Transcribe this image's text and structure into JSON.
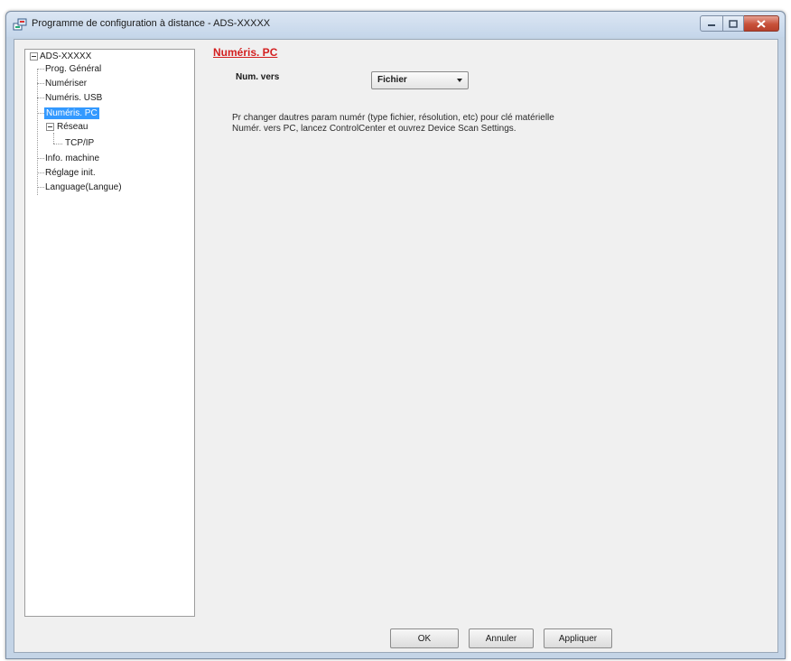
{
  "window": {
    "title": "Programme de configuration à distance - ADS-XXXXX",
    "icon": "remote-setup-app-icon"
  },
  "tree": {
    "root": "ADS-XXXXX",
    "items": [
      {
        "label": "Prog. Général"
      },
      {
        "label": "Numériser"
      },
      {
        "label": "Numéris. USB"
      },
      {
        "label": "Numéris. PC",
        "selected": true
      },
      {
        "label": "Réseau"
      },
      {
        "label": "TCP/IP"
      },
      {
        "label": "Info. machine"
      },
      {
        "label": "Réglage init."
      },
      {
        "label": "Language(Langue)"
      }
    ]
  },
  "panel": {
    "title": "Numéris. PC",
    "scan_to_label": "Num. vers",
    "scan_to_value": "Fichier",
    "info_line1": "Pr changer dautres param numér (type fichier, résolution, etc) pour clé matérielle",
    "info_line2": "Numér. vers PC, lancez ControlCenter et ouvrez Device Scan Settings."
  },
  "buttons": {
    "ok": "OK",
    "cancel": "Annuler",
    "apply": "Appliquer"
  },
  "colors": {
    "section_title": "#d31f1f",
    "selection": "#3399ff",
    "close_button": "#c7513a"
  }
}
